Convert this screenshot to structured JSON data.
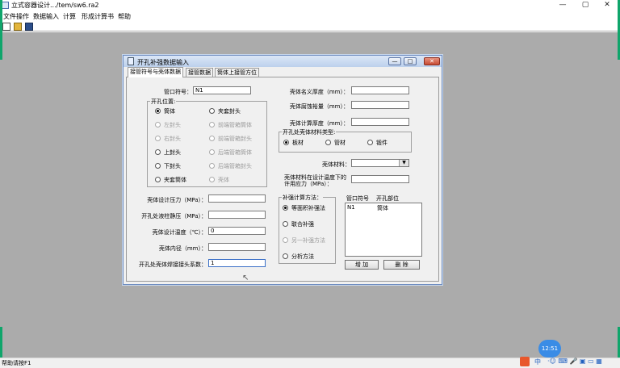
{
  "window": {
    "title": "立式容器设计.../tem/sw6.ra2"
  },
  "menu": [
    "文件操作",
    "数据输入",
    "计算",
    "形成计算书",
    "帮助"
  ],
  "status": "帮助请按F1",
  "dialog": {
    "title": "开孔补强数据输入",
    "tabs": [
      "接管符号与壳体数据",
      "接管数据",
      "筒体上接管方位"
    ],
    "nozzle_symbol_label": "管口符号：",
    "nozzle_symbol_value": "N1",
    "opening_pos_title": "开孔位置:",
    "opening_positions": [
      {
        "label": "筒体",
        "state": "on"
      },
      {
        "label": "夹套封头",
        "state": ""
      },
      {
        "label": "左封头",
        "state": "dis"
      },
      {
        "label": "前端管箱筒体",
        "state": "dis"
      },
      {
        "label": "右封头",
        "state": "dis"
      },
      {
        "label": "前端管箱封头",
        "state": "dis"
      },
      {
        "label": "上封头",
        "state": ""
      },
      {
        "label": "后端管箱筒体",
        "state": "dis"
      },
      {
        "label": "下封头",
        "state": ""
      },
      {
        "label": "后端管箱封头",
        "state": "dis"
      },
      {
        "label": "夹套筒体",
        "state": ""
      },
      {
        "label": "壳体",
        "state": "dis"
      }
    ],
    "left_fields": [
      {
        "label": "壳体设计压力（MPa）：",
        "value": ""
      },
      {
        "label": "开孔处液柱静压（MPa）：",
        "value": ""
      },
      {
        "label": "壳体设计温度（℃）：",
        "value": "0"
      },
      {
        "label": "壳体内径（mm）：",
        "value": ""
      },
      {
        "label": "开孔处壳体焊接接头系数：",
        "value": "1"
      }
    ],
    "right_fields": [
      {
        "label": "壳体名义厚度（mm）：",
        "value": ""
      },
      {
        "label": "壳体腐蚀裕量（mm）：",
        "value": ""
      },
      {
        "label": "壳体计算厚度（mm）：",
        "value": ""
      }
    ],
    "material_type_title": "开孔处壳体材料类型:",
    "material_types": [
      {
        "label": "板材",
        "state": "on"
      },
      {
        "label": "管材",
        "state": ""
      },
      {
        "label": "锻件",
        "state": ""
      }
    ],
    "shell_material_label": "壳体材料：",
    "shell_material_value": "",
    "allow_stress_label": "壳体材料在设计温度下的许用应力（MPa）：",
    "allow_stress_value": "",
    "calc_method_title": "补强计算方法：",
    "calc_methods": [
      {
        "label": "等面积补强法",
        "state": "on"
      },
      {
        "label": "联合补强",
        "state": ""
      },
      {
        "label": "另一补强方法",
        "state": "dis"
      },
      {
        "label": "分析方法",
        "state": ""
      }
    ],
    "list_headers": [
      "管口符号",
      "开孔部位"
    ],
    "list_rows": [
      [
        "N1",
        "筒体"
      ]
    ],
    "add_label": "增 加",
    "delete_label": "删 除"
  },
  "clock": "12:51",
  "tray_text": "中"
}
